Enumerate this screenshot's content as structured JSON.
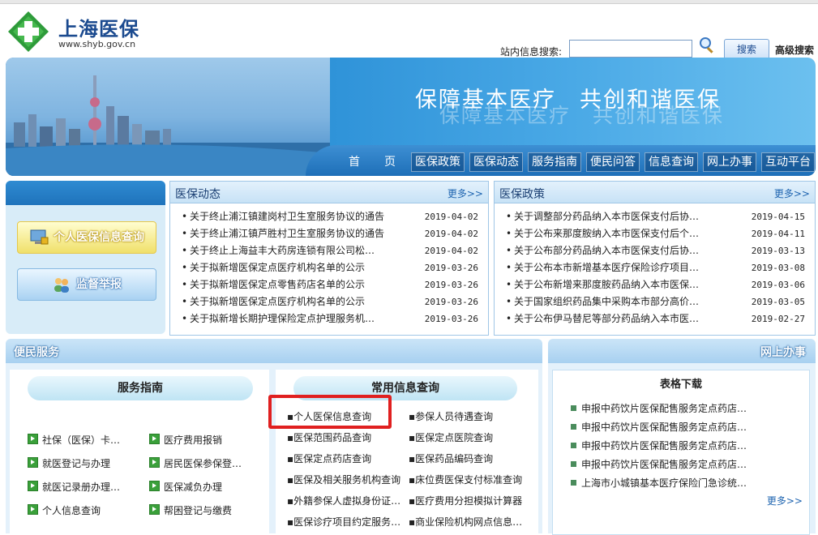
{
  "header": {
    "site_title": "上海医保",
    "site_url": "www.shyb.gov.cn",
    "search_label": "站内信息搜索:",
    "search_value": "",
    "search_button": "搜索",
    "advanced_search": "高级搜索"
  },
  "banner": {
    "slogan": "保障基本医疗　共创和谐医保"
  },
  "nav": [
    "首　页",
    "医保政策",
    "医保动态",
    "服务指南",
    "便民问答",
    "信息查询",
    "网上办事",
    "互动平台"
  ],
  "quick_links": {
    "personal_query": "个人医保信息查询",
    "report": "监督举报"
  },
  "dynamics": {
    "title": "医保动态",
    "more": "更多>>",
    "items": [
      {
        "title": "关于终止浦江镇建岗村卫生室服务协议的通告",
        "date": "2019-04-02"
      },
      {
        "title": "关于终止浦江镇芦胜村卫生室服务协议的通告",
        "date": "2019-04-02"
      },
      {
        "title": "关于终止上海益丰大药房连锁有限公司松…",
        "date": "2019-04-02"
      },
      {
        "title": "关于拟新增医保定点医疗机构名单的公示",
        "date": "2019-03-26"
      },
      {
        "title": "关于拟新增医保定点零售药店名单的公示",
        "date": "2019-03-26"
      },
      {
        "title": "关于拟新增医保定点医疗机构名单的公示",
        "date": "2019-03-26"
      },
      {
        "title": "关于拟新增长期护理保险定点护理服务机…",
        "date": "2019-03-26"
      }
    ]
  },
  "policy": {
    "title": "医保政策",
    "more": "更多>>",
    "items": [
      {
        "title": "关于调整部分药品纳入本市医保支付后协…",
        "date": "2019-04-15"
      },
      {
        "title": "关于公布来那度胺纳入本市医保支付后个…",
        "date": "2019-04-11"
      },
      {
        "title": "关于公布部分药品纳入本市医保支付后协…",
        "date": "2019-03-13"
      },
      {
        "title": "关于公布本市新增基本医疗保险诊疗项目…",
        "date": "2019-03-08"
      },
      {
        "title": "关于公布新增来那度胺药品纳入本市医保…",
        "date": "2019-03-06"
      },
      {
        "title": "关于国家组织药品集中采购本市部分高价…",
        "date": "2019-03-05"
      },
      {
        "title": "关于公布伊马替尼等部分药品纳入本市医…",
        "date": "2019-02-27"
      }
    ]
  },
  "convenience": {
    "title": "便民服务",
    "guide_title": "服务指南",
    "guide_items": [
      "社保（医保）卡…",
      "医疗费用报销",
      "就医登记与办理",
      "居民医保参保登…",
      "就医记录册办理…",
      "医保减负办理",
      "个人信息查询",
      "帮困登记与缴费"
    ],
    "info_title": "常用信息查询",
    "info_items": [
      "个人医保信息查询",
      "参保人员待遇查询",
      "医保范围药品查询",
      "医保定点医院查询",
      "医保定点药店查询",
      "医保药品编码查询",
      "医保及相关服务机构查询",
      "床位费医保支付标准查询",
      "外籍参保人虚拟身份证…",
      "医疗费用分担模拟计算器",
      "医保诊疗项目约定服务…",
      "商业保险机构网点信息…"
    ]
  },
  "online": {
    "title": "网上办事",
    "forms_title": "表格下载",
    "forms": [
      "申报中药饮片医保配售服务定点药店…",
      "申报中药饮片医保配售服务定点药店…",
      "申报中药饮片医保配售服务定点药店…",
      "申报中药饮片医保配售服务定点药店…",
      "上海市小城镇基本医疗保险门急诊统…"
    ],
    "more": "更多>>"
  },
  "colors": {
    "brand_blue": "#1b4a8f",
    "banner_blue": "#2a8fd6",
    "highlight_red": "#e02020"
  }
}
